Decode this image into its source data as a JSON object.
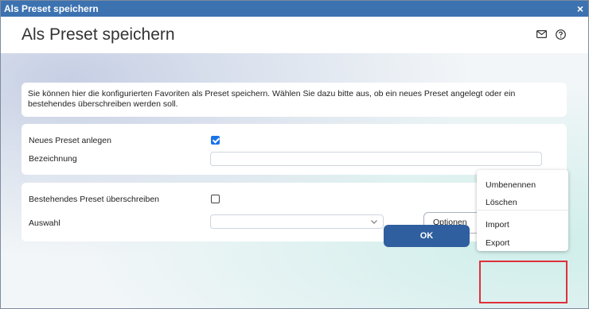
{
  "window": {
    "title": "Als Preset speichern",
    "close_glyph": "×"
  },
  "header": {
    "title": "Als Preset speichern",
    "icons": [
      "mail-icon",
      "help-icon"
    ]
  },
  "info": {
    "text": "Sie können hier die konfigurierten Favoriten als Preset speichern. Wählen Sie dazu bitte aus, ob ein neues Preset angelegt oder ein bestehendes überschreiben werden soll."
  },
  "new_preset": {
    "label": "Neues Preset anlegen",
    "checked": true,
    "name_label": "Bezeichnung",
    "name_value": ""
  },
  "existing_preset": {
    "label": "Bestehendes Preset überschreiben",
    "checked": false,
    "select_label": "Auswahl",
    "select_value": "",
    "options_button": "Optionen"
  },
  "menu": {
    "items": [
      "Umbenennen",
      "Löschen",
      "Import",
      "Export"
    ]
  },
  "footer": {
    "ok_label": "OK"
  },
  "colors": {
    "titlebar": "#3c72b0",
    "ok_button": "#2f5f9e",
    "checkbox_on": "#1a73e8",
    "highlight": "#e0303a"
  }
}
